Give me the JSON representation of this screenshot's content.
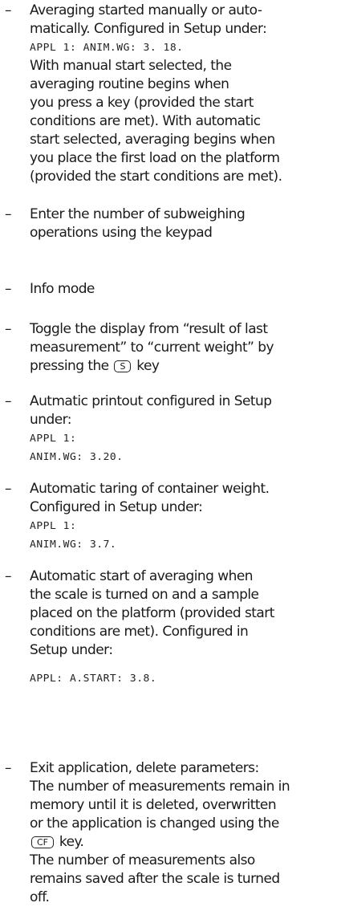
{
  "dash": "–",
  "items": [
    {
      "lines": [
        {
          "t": "Averaging started manually or auto-"
        },
        {
          "t": "matically. Configured in Setup under:"
        },
        {
          "t": "APPL 1: ANIM.WG:  3. 18.",
          "lcd": true
        },
        {
          "t": "With manual start selected, the"
        },
        {
          "t": "averaging routine begins when"
        },
        {
          "t": "you press a key (provided the start"
        },
        {
          "t": "conditions are met). With automatic"
        },
        {
          "t": "start selected, averaging begins when"
        },
        {
          "t": "you place the first load on the platform"
        },
        {
          "t": "(provided the start conditions are met)."
        }
      ]
    },
    {
      "lines": [
        {
          "t": "Enter the number of subweighing"
        },
        {
          "t": "operations using the keypad"
        }
      ]
    },
    {
      "lines": [
        {
          "t": "Info mode"
        }
      ]
    },
    {
      "lines": [
        {
          "t": "Toggle the display from “result of last"
        },
        {
          "t": "measurement” to “current weight” by"
        },
        {
          "pre": "pressing the",
          "key": "S",
          "post": "key"
        }
      ]
    },
    {
      "lines": [
        {
          "t": "Autmatic printout configured in Setup"
        },
        {
          "t": "under:"
        },
        {
          "t": "APPL 1:",
          "lcd": true
        },
        {
          "t": "ANIM.WG:  3.20.",
          "lcd": true
        }
      ]
    },
    {
      "lines": [
        {
          "t": "Automatic taring of container weight."
        },
        {
          "t": "Configured in Setup under:"
        },
        {
          "t": "APPL 1:",
          "lcd": true
        },
        {
          "t": "ANIM.WG: 3.7.",
          "lcd": true
        }
      ]
    },
    {
      "lines": [
        {
          "t": "Automatic start of averaging when"
        },
        {
          "t": "the scale is turned on and a sample"
        },
        {
          "t": "placed on the platform (provided start"
        },
        {
          "t": "conditions are met). Configured in"
        },
        {
          "t": "Setup under:"
        },
        {
          "t": ""
        },
        {
          "t": "APPL: A.START: 3.8.",
          "lcd": true
        }
      ]
    },
    {
      "lines": [
        {
          "t": "Exit application, delete parameters:"
        },
        {
          "t": "The number of measurements remain in"
        },
        {
          "t": "memory until it is deleted, overwritten"
        },
        {
          "t": "or the application is changed using the"
        },
        {
          "pre": "",
          "key": "CF",
          "post": "key."
        },
        {
          "t": "The number of measurements also"
        },
        {
          "t": "remains saved after the scale is turned"
        },
        {
          "t": "off."
        }
      ]
    }
  ]
}
